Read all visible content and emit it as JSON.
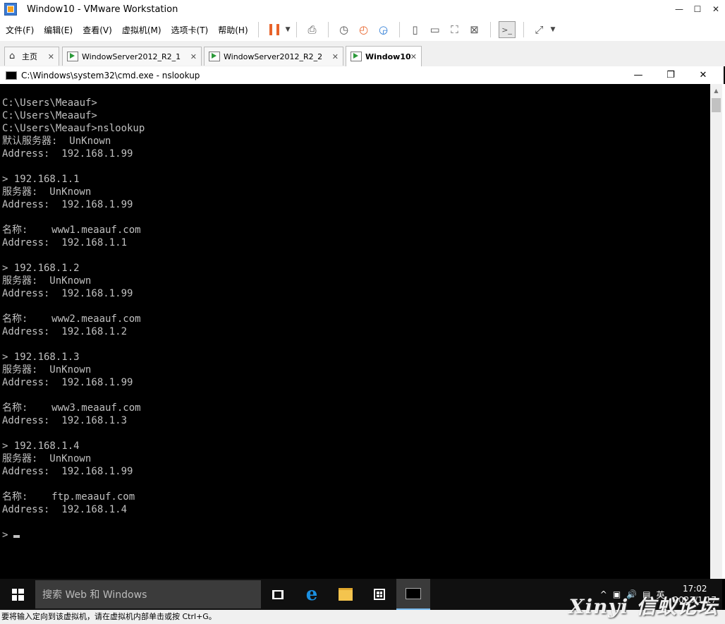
{
  "window": {
    "title": "Window10 - VMware Workstation",
    "min": "—",
    "max": "☐",
    "close": "✕"
  },
  "menu": [
    "文件(F)",
    "编辑(E)",
    "查看(V)",
    "虚拟机(M)",
    "选项卡(T)",
    "帮助(H)"
  ],
  "tabs": [
    {
      "label": "主页",
      "close": "✕"
    },
    {
      "label": "WindowServer2012_R2_1",
      "close": "✕"
    },
    {
      "label": "WindowServer2012_R2_2",
      "close": "✕"
    },
    {
      "label": "Window10",
      "close": "✕"
    }
  ],
  "cmd": {
    "title": "C:\\Windows\\system32\\cmd.exe - nslookup",
    "min": "—",
    "max": "❐",
    "close": "✕",
    "lines": [
      "",
      "C:\\Users\\Meaauf>",
      "C:\\Users\\Meaauf>",
      "C:\\Users\\Meaauf>nslookup",
      "默认服务器:  UnKnown",
      "Address:  192.168.1.99",
      "",
      "> 192.168.1.1",
      "服务器:  UnKnown",
      "Address:  192.168.1.99",
      "",
      "名称:    www1.meaauf.com",
      "Address:  192.168.1.1",
      "",
      "> 192.168.1.2",
      "服务器:  UnKnown",
      "Address:  192.168.1.99",
      "",
      "名称:    www2.meaauf.com",
      "Address:  192.168.1.2",
      "",
      "> 192.168.1.3",
      "服务器:  UnKnown",
      "Address:  192.168.1.99",
      "",
      "名称:    www3.meaauf.com",
      "Address:  192.168.1.3",
      "",
      "> 192.168.1.4",
      "服务器:  UnKnown",
      "Address:  192.168.1.99",
      "",
      "名称:    ftp.meaauf.com",
      "Address:  192.168.1.4",
      "",
      ">"
    ]
  },
  "taskbar": {
    "search_placeholder": "搜索 Web 和 Windows",
    "tray_up": "^",
    "ime": "英",
    "time": "17:02",
    "date": "2023/1/17"
  },
  "status": "要将输入定向到该虚拟机，请在虚拟机内部单击或按 Ctrl+G。",
  "watermark": "Xinyi 信蚁论坛",
  "colors": {
    "accent": "#e8632a",
    "console_bg": "#000000",
    "console_fg": "#c0c0c0",
    "taskbar": "#101010"
  }
}
